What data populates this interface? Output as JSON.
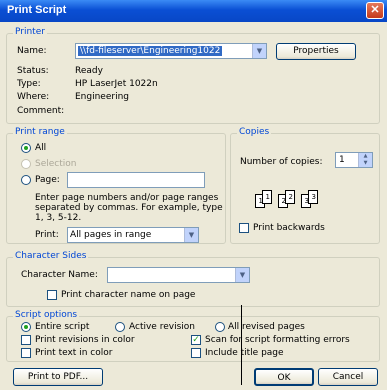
{
  "window": {
    "title": "Print Script",
    "close_glyph": "✕"
  },
  "printer": {
    "legend": "Printer",
    "name_label": "Name:",
    "name_value": "\\\\fd-fileserver\\Engineering1022",
    "properties_label": "Properties",
    "status_label": "Status:",
    "status_value": "Ready",
    "type_label": "Type:",
    "type_value": "HP LaserJet 1022n",
    "where_label": "Where:",
    "where_value": "Engineering",
    "comment_label": "Comment:"
  },
  "print_range": {
    "legend": "Print range",
    "all_label": "All",
    "selection_label": "Selection",
    "page_label": "Page:",
    "page_value": "",
    "help_text_1": "Enter page numbers and/or page ranges",
    "help_text_2": "separated by commas. For example, type",
    "help_text_3": "1, 3, 5-12.",
    "print_label": "Print:",
    "print_value": "All pages in range"
  },
  "copies": {
    "legend": "Copies",
    "number_label": "Number of copies:",
    "number_value": "1",
    "collate_pages": [
      "1",
      "1",
      "2",
      "2",
      "3",
      "3"
    ],
    "backwards_label": "Print backwards"
  },
  "character_sides": {
    "legend": "Character Sides",
    "character_name_label": "Character Name:",
    "character_name_value": "",
    "print_name_label": "Print character name on page"
  },
  "script_options": {
    "legend": "Script options",
    "entire_label": "Entire script",
    "active_label": "Active revision",
    "all_revised_label": "All revised pages",
    "revisions_color_label": "Print revisions in color",
    "scan_label": "Scan for script formatting errors",
    "text_color_label": "Print text in color",
    "title_page_label": "Include title page"
  },
  "buttons": {
    "pdf": "Print to PDF...",
    "ok": "OK",
    "cancel": "Cancel"
  },
  "icons": {
    "dropdown": "▼",
    "spin_up": "▲",
    "spin_down": "▼",
    "check": "✓"
  }
}
